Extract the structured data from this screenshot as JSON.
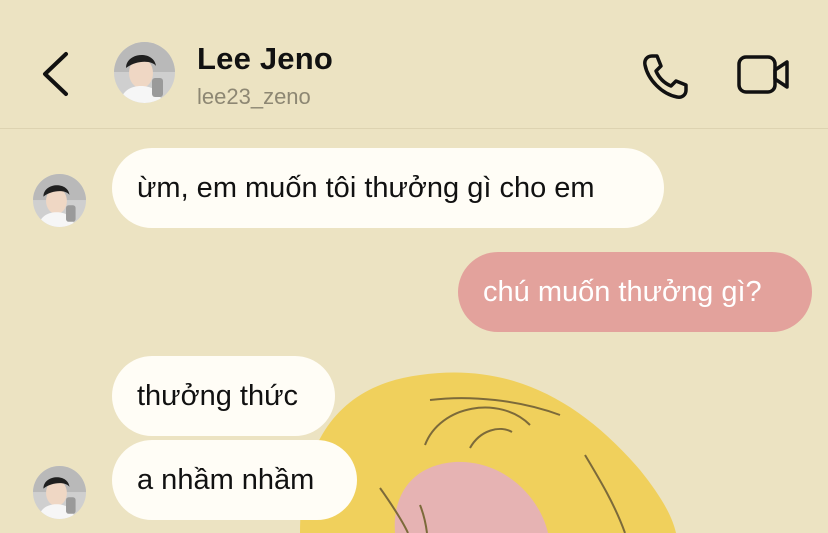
{
  "theme": {
    "background": "#ece3c2",
    "incoming_bubble": "#fffdf6",
    "outgoing_bubble": "#e3a29c",
    "text": "#111111",
    "secondary_text": "#8d8773"
  },
  "header": {
    "back_icon": "chevron-left-icon",
    "display_name": "Lee Jeno",
    "username": "lee23_zeno",
    "call_icon": "phone-icon",
    "video_icon": "video-camera-icon"
  },
  "messages": [
    {
      "sender": "them",
      "text": "ừm, em muốn tôi thưởng gì cho em"
    },
    {
      "sender": "me",
      "text": "chú muốn thưởng gì?"
    },
    {
      "sender": "them",
      "text": "thưởng thức"
    },
    {
      "sender": "them",
      "text": "a nhầm nhầm"
    }
  ]
}
